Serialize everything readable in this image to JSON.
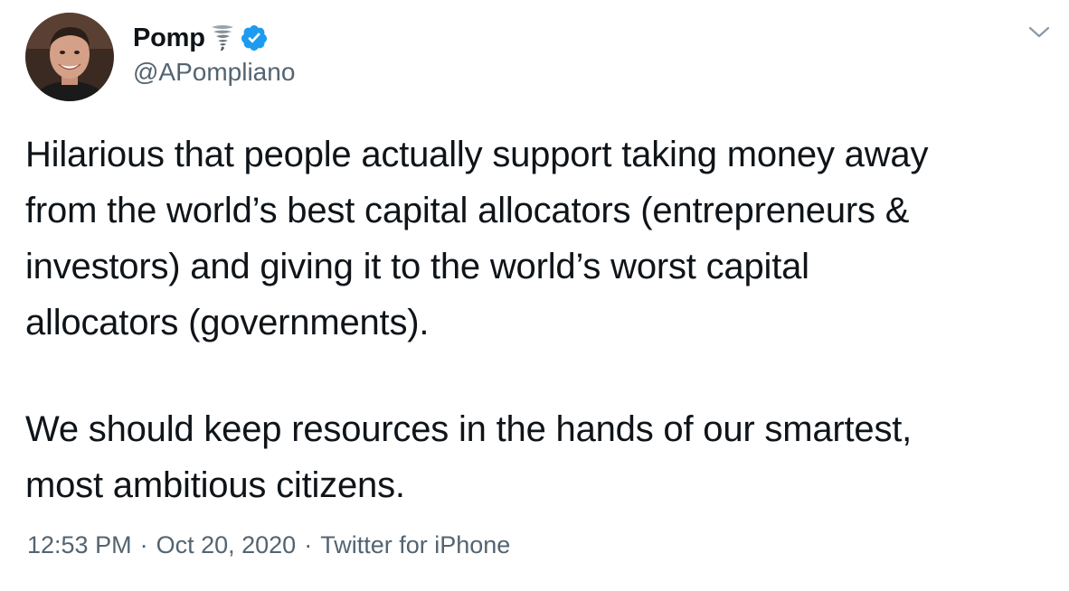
{
  "author": {
    "display_name": "Pomp",
    "handle": "@APompliano",
    "name_emoji": "tornado-icon",
    "verified": true,
    "verified_color": "#1d9bf0"
  },
  "tweet": {
    "paragraphs": [
      "Hilarious that people actually support taking money away\nfrom the world’s best capital allocators (entrepreneurs &\ninvestors) and giving it to the world’s worst capital\nallocators (governments).",
      "We should keep resources in the hands of our smartest,\nmost ambitious citizens."
    ],
    "time": "12:53 PM",
    "separator": "·",
    "date": "Oct 20, 2020",
    "source": "Twitter for iPhone"
  },
  "icons": {
    "menu": "chevron-down-icon",
    "verified": "verified-badge-icon"
  },
  "colors": {
    "text": "#0f1419",
    "secondary": "#536471",
    "background": "#ffffff"
  }
}
